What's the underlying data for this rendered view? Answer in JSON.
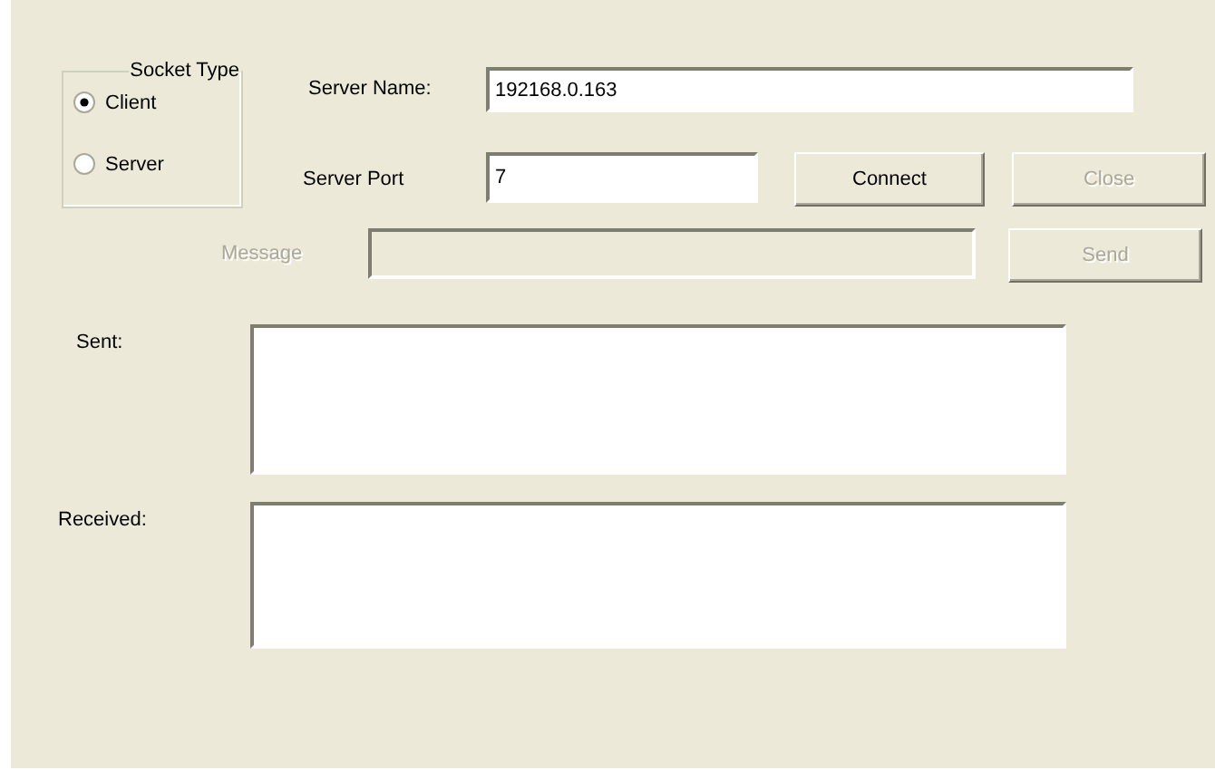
{
  "socket_type": {
    "title": "Socket Type",
    "options": [
      {
        "label": "Client",
        "selected": true
      },
      {
        "label": "Server",
        "selected": false
      }
    ]
  },
  "server_name": {
    "label": "Server Name:",
    "value": "192168.0.163"
  },
  "server_port": {
    "label": "Server Port",
    "value": "7"
  },
  "connection_buttons": [
    {
      "label": "Connect",
      "disabled": false
    },
    {
      "label": "Close",
      "disabled": true
    }
  ],
  "message": {
    "label": "Message",
    "disabled": true
  },
  "send_button": {
    "label": "Send",
    "disabled": true
  },
  "sent": {
    "label": "Sent:"
  },
  "received": {
    "label": "Received:"
  }
}
